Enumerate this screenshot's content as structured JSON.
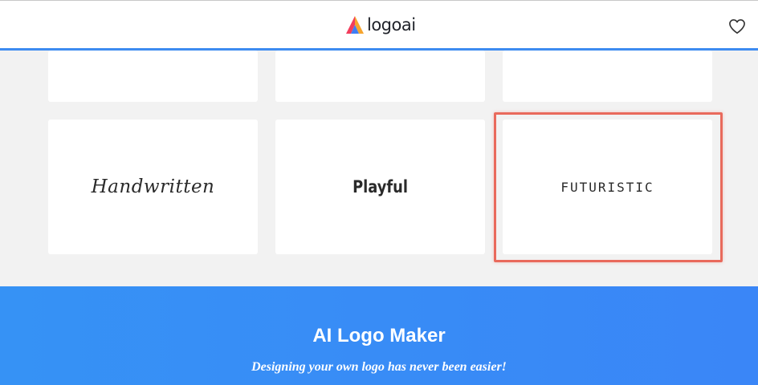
{
  "header": {
    "brand": "logoai",
    "favorites_icon": "heart-icon"
  },
  "styles": {
    "top_row": [
      "",
      "",
      ""
    ],
    "cards": [
      {
        "label": "Handwritten"
      },
      {
        "label": "Playful"
      },
      {
        "label": "FUTURISTIC"
      }
    ],
    "highlighted": "FUTURISTIC"
  },
  "hero": {
    "title": "AI Logo Maker",
    "subtitle": "Designing your own logo has never been easier!"
  },
  "colors": {
    "accent": "#3d8bf0",
    "hero_bg": "#3692f5",
    "highlight": "#e96a5c",
    "page_bg": "#f2f2f2"
  }
}
